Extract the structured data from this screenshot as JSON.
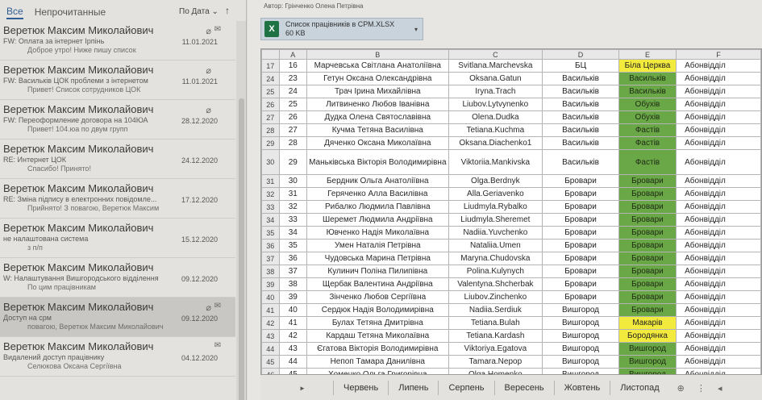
{
  "mail_list": {
    "filter_all": "Все",
    "filter_unread": "Непрочитанные",
    "sort_label": "По Дата",
    "sort_direction": "↑",
    "items": [
      {
        "sender": "Веретюк Максим Миколайович",
        "subject": "FW: Оплата за інтернет Ірпінь",
        "preview": "Доброе утро! Ниже пишу список",
        "date": "11.01.2021",
        "attach": true,
        "env": true,
        "selected": false
      },
      {
        "sender": "Веретюк Максим Миколайович",
        "subject": "FW: Васильків ЦОК проблеми з інтернетом",
        "preview": "Привет! Список сотрудников ЦОК",
        "date": "11.01.2021",
        "attach": true,
        "env": false,
        "selected": false
      },
      {
        "sender": "Веретюк Максим Миколайович",
        "subject": "FW: Переоформление договора на 104ЮА",
        "preview": "Привет! 104.юа по двум групп",
        "date": "28.12.2020",
        "attach": true,
        "env": false,
        "selected": false
      },
      {
        "sender": "Веретюк Максим Миколайович",
        "subject": "RE: Интернет ЦОК",
        "preview": "Спасибо! Принято!",
        "date": "24.12.2020",
        "attach": false,
        "env": false,
        "selected": false
      },
      {
        "sender": "Веретюк Максим Миколайович",
        "subject": "RE: Зміна підпису в електронних повідомле...",
        "preview": "Прийнято! З повагою, Веретюк Максим",
        "date": "17.12.2020",
        "attach": false,
        "env": false,
        "selected": false
      },
      {
        "sender": "Веретюк Максим Миколайович",
        "subject": "не налаштована система",
        "preview": "з п/п",
        "date": "15.12.2020",
        "attach": false,
        "env": false,
        "selected": false
      },
      {
        "sender": "Веретюк Максим Миколайович",
        "subject": "W: Налаштування Вишгородського відділення",
        "preview": "По цим працівникам",
        "date": "09.12.2020",
        "attach": false,
        "env": false,
        "selected": false
      },
      {
        "sender": "Веретюк Максим Миколайович",
        "subject": "Доступ на срм",
        "preview": "повагою, Веретюк Максим Миколайович",
        "date": "09.12.2020",
        "attach": true,
        "env": true,
        "selected": true
      },
      {
        "sender": "Веретюк Максим Миколайович",
        "subject": "Видалений доступ працівнику",
        "preview": "Селюкова Оксана Сергіївна",
        "date": "04.12.2020",
        "attach": false,
        "env": true,
        "selected": false
      }
    ]
  },
  "reading": {
    "author": "Автор: Грінченко Олена Петрівна",
    "attachment_name": "Список працівників в СРМ.XLSX",
    "attachment_size": "60 KB",
    "attachment_icon": "excel-icon"
  },
  "spreadsheet": {
    "columns": [
      "A",
      "B",
      "C",
      "D",
      "E",
      "F"
    ],
    "rows": [
      {
        "rn": "17",
        "a": "16",
        "b": "Марчевська Світлана Анатоліївна",
        "c": "Svitlana.Marchevska",
        "d": "БЦ",
        "e": "Біла Церква",
        "f": "Абонвідділ",
        "e_color": "yellow"
      },
      {
        "rn": "24",
        "a": "23",
        "b": "Гетун Оксана Олександрівна",
        "c": "Oksana.Gatun",
        "d": "Васильків",
        "e": "Васильків",
        "f": "Абонвідділ",
        "e_color": "green"
      },
      {
        "rn": "25",
        "a": "24",
        "b": "Трач Ірина Михайлівна",
        "c": "Iryna.Trach",
        "d": "Васильків",
        "e": "Васильків",
        "f": "Абонвідділ",
        "e_color": "green"
      },
      {
        "rn": "26",
        "a": "25",
        "b": "Литвиненко Любов Іванівна",
        "c": "Liubov.Lytvynenko",
        "d": "Васильків",
        "e": "Обухів",
        "f": "Абонвідділ",
        "e_color": "green"
      },
      {
        "rn": "27",
        "a": "26",
        "b": "Дудка Олена Святославівна",
        "c": "Olena.Dudka",
        "d": "Васильків",
        "e": "Обухів",
        "f": "Абонвідділ",
        "e_color": "green"
      },
      {
        "rn": "28",
        "a": "27",
        "b": "Кучма Тетяна Василівна",
        "c": "Tetiana.Kuchma",
        "d": "Васильків",
        "e": "Фастів",
        "f": "Абонвідділ",
        "e_color": "green"
      },
      {
        "rn": "29",
        "a": "28",
        "b": "Дяченко Оксана Миколаївна",
        "c": "Oksana.Diachenko1",
        "d": "Васильків",
        "e": "Фастів",
        "f": "Абонвідділ",
        "e_color": "green"
      },
      {
        "rn": "30",
        "a": "29",
        "b": "Маньківська Вікторія Володимирівна",
        "c": "Viktoriia.Mankivska",
        "d": "Васильків",
        "e": "Фастів",
        "f": "Абонвідділ",
        "e_color": "green",
        "tall": true
      },
      {
        "rn": "31",
        "a": "30",
        "b": "Бердник Ольга Анатоліївна",
        "c": "Olga.Berdnyk",
        "d": "Бровари",
        "e": "Бровари",
        "f": "Абонвідділ",
        "e_color": "green"
      },
      {
        "rn": "32",
        "a": "31",
        "b": "Геряченко Алла Василівна",
        "c": "Alla.Geriavenko",
        "d": "Бровари",
        "e": "Бровари",
        "f": "Абонвідділ",
        "e_color": "green"
      },
      {
        "rn": "33",
        "a": "32",
        "b": "Рибалко Людмила Павлівна",
        "c": "Liudmyla.Rybalko",
        "d": "Бровари",
        "e": "Бровари",
        "f": "Абонвідділ",
        "e_color": "green"
      },
      {
        "rn": "34",
        "a": "33",
        "b": "Шеремет Людмила Андріївна",
        "c": "Liudmyla.Sheremet",
        "d": "Бровари",
        "e": "Бровари",
        "f": "Абонвідділ",
        "e_color": "green"
      },
      {
        "rn": "35",
        "a": "34",
        "b": "Ювченко Надія Миколаївна",
        "c": "Nadiia.Yuvchenko",
        "d": "Бровари",
        "e": "Бровари",
        "f": "Абонвідділ",
        "e_color": "green"
      },
      {
        "rn": "36",
        "a": "35",
        "b": "Умен Наталія Петрівна",
        "c": "Nataliia.Umen",
        "d": "Бровари",
        "e": "Бровари",
        "f": "Абонвідділ",
        "e_color": "green"
      },
      {
        "rn": "37",
        "a": "36",
        "b": "Чудовська Марина Петрівна",
        "c": "Maryna.Chudovska",
        "d": "Бровари",
        "e": "Бровари",
        "f": "Абонвідділ",
        "e_color": "green"
      },
      {
        "rn": "38",
        "a": "37",
        "b": "Кулинич Поліна Пилипівна",
        "c": "Polina.Kulynych",
        "d": "Бровари",
        "e": "Бровари",
        "f": "Абонвідділ",
        "e_color": "green"
      },
      {
        "rn": "39",
        "a": "38",
        "b": "Щербак Валентина Андріївна",
        "c": "Valentyna.Shcherbak",
        "d": "Бровари",
        "e": "Бровари",
        "f": "Абонвідділ",
        "e_color": "green"
      },
      {
        "rn": "40",
        "a": "39",
        "b": "Зінченко Любов Сергіївна",
        "c": "Liubov.Zinchenko",
        "d": "Бровари",
        "e": "Бровари",
        "f": "Абонвідділ",
        "e_color": "green"
      },
      {
        "rn": "41",
        "a": "40",
        "b": "Сердюк Надія Володимирівна",
        "c": "Nadiia.Serdiuk",
        "d": "Вишгород",
        "e": "Бровари",
        "f": "Абонвідділ",
        "e_color": "green"
      },
      {
        "rn": "42",
        "a": "41",
        "b": "Булах Тетяна Дмитрівна",
        "c": "Tetiana.Bulah",
        "d": "Вишгород",
        "e": "Макарів",
        "f": "Абонвідділ",
        "e_color": "yellow"
      },
      {
        "rn": "43",
        "a": "42",
        "b": "Кардаш Тетяна Миколаївна",
        "c": "Tetiana.Kardash",
        "d": "Вишгород",
        "e": "Бородянка",
        "f": "Абонвідділ",
        "e_color": "yellow"
      },
      {
        "rn": "44",
        "a": "43",
        "b": "Єгатова Вікторія Володимирівна",
        "c": "Viktoriya.Egatova",
        "d": "Вишгород",
        "e": "Вишгород",
        "f": "Абонвідділ",
        "e_color": "green"
      },
      {
        "rn": "45",
        "a": "44",
        "b": "Непоп Тамара Данилівна",
        "c": "Tamara.Nepop",
        "d": "Вишгород",
        "e": "Вишгород",
        "f": "Абонвідділ",
        "e_color": "green"
      },
      {
        "rn": "46",
        "a": "45",
        "b": "Хоменко Ольга Григорівна",
        "c": "Olga.Homenko",
        "d": "Вишгород",
        "e": "Вишгород",
        "f": "Абонвідділ",
        "e_color": "green"
      }
    ],
    "tabs": [
      "Червень",
      "Липень",
      "Серпень",
      "Вересень",
      "Жовтень",
      "Листопад"
    ]
  }
}
